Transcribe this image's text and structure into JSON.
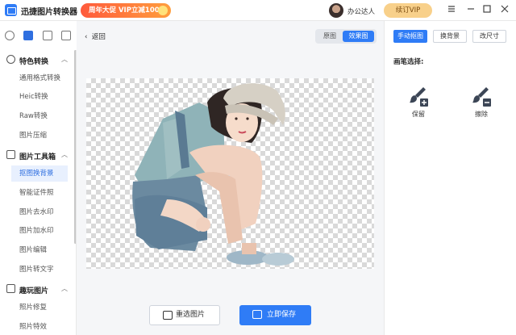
{
  "app": {
    "title": "迅捷图片转换器",
    "promo": "周年大促 VIP立减100元",
    "user_name": "办公达人",
    "vip_button": "续订VIP"
  },
  "window_controls": [
    "—",
    "▢",
    "□",
    "✕"
  ],
  "sidebar": {
    "sections": [
      {
        "label": "特色转换",
        "items": [
          "通用格式转换",
          "Heic转换",
          "Raw转换",
          "图片压缩"
        ]
      },
      {
        "label": "图片工具箱",
        "items": [
          "抠图换背景",
          "智能证件照",
          "图片去水印",
          "图片加水印",
          "图片编辑",
          "图片转文字"
        ]
      },
      {
        "label": "趣玩图片",
        "items": [
          "照片修复",
          "照片特效"
        ]
      }
    ],
    "active_item": "抠图换背景"
  },
  "main": {
    "back_label": "返回",
    "view_toggle": {
      "original": "原图",
      "effect": "效果图",
      "selected": "效果图"
    },
    "reselect_button": "重选图片",
    "save_button": "立即保存"
  },
  "panel": {
    "tabs": [
      "手动抠图",
      "换背景",
      "改尺寸"
    ],
    "active_tab": "手动抠图",
    "pen_title": "画笔选择:",
    "tools": [
      "保留",
      "擦除"
    ]
  },
  "colors": {
    "accent": "#2f7cf6",
    "promo": "#ff5a3c",
    "vip": "#f8d08a"
  }
}
